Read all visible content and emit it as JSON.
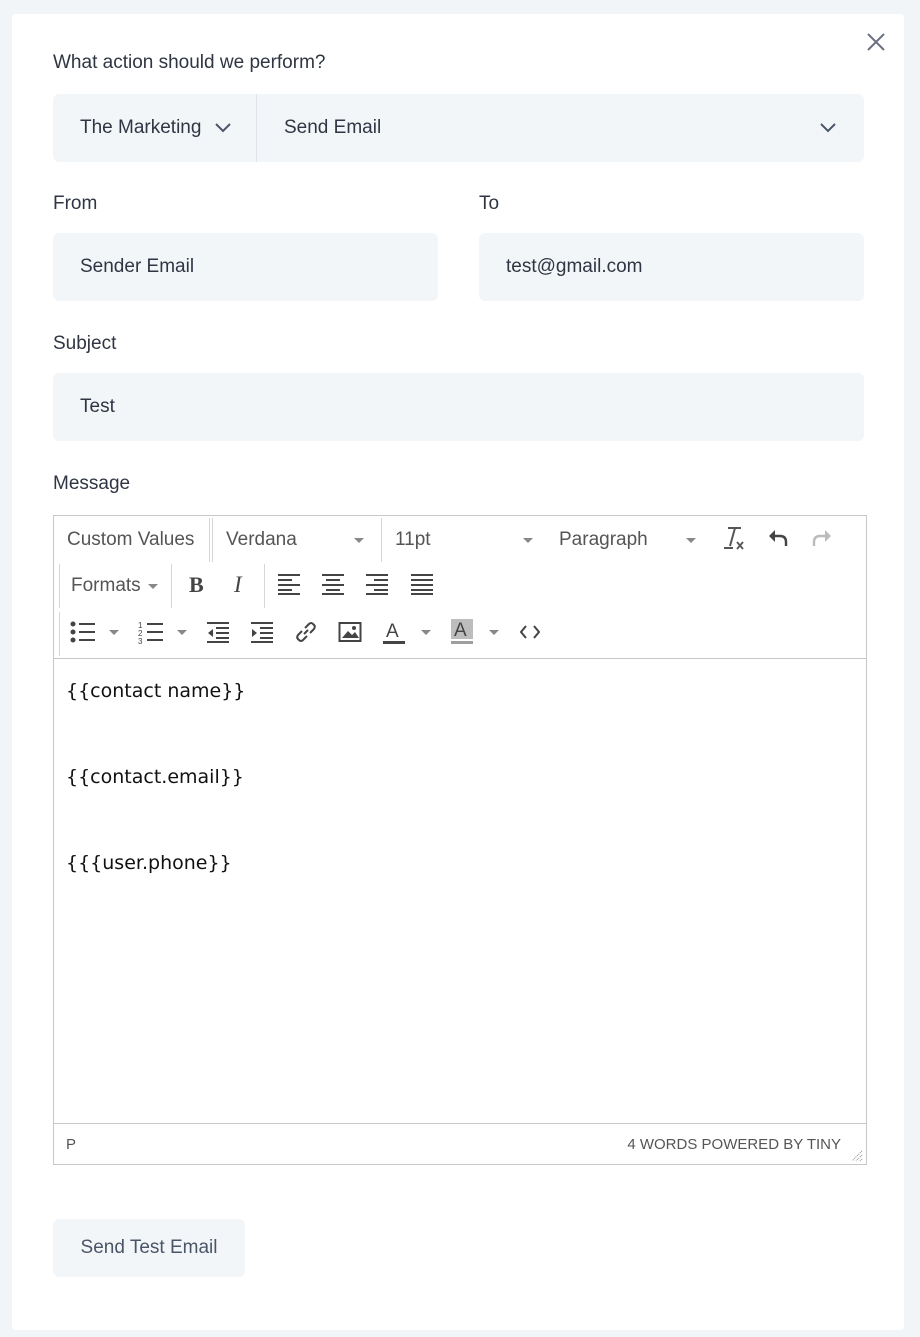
{
  "form": {
    "question": "What action should we perform?",
    "app_select": "The Marketing",
    "action_select": "Send Email",
    "from_label": "From",
    "from_value": "Sender Email",
    "to_label": "To",
    "to_value": "test@gmail.com",
    "subject_label": "Subject",
    "subject_value": "Test",
    "message_label": "Message"
  },
  "editor": {
    "toolbar": {
      "custom_values": "Custom Values",
      "font_family": "Verdana",
      "font_size": "11pt",
      "block_format": "Paragraph",
      "formats": "Formats"
    },
    "content": [
      "{{contact name}}",
      "{{contact.email}}",
      "{{{user.phone}}"
    ],
    "status_path": "P",
    "status_right": "4 WORDS POWERED BY TINY"
  },
  "actions": {
    "send_test": "Send Test Email"
  },
  "colors": {
    "field_bg": "#f3f6f9",
    "page_bg": "#f2f5f8"
  }
}
